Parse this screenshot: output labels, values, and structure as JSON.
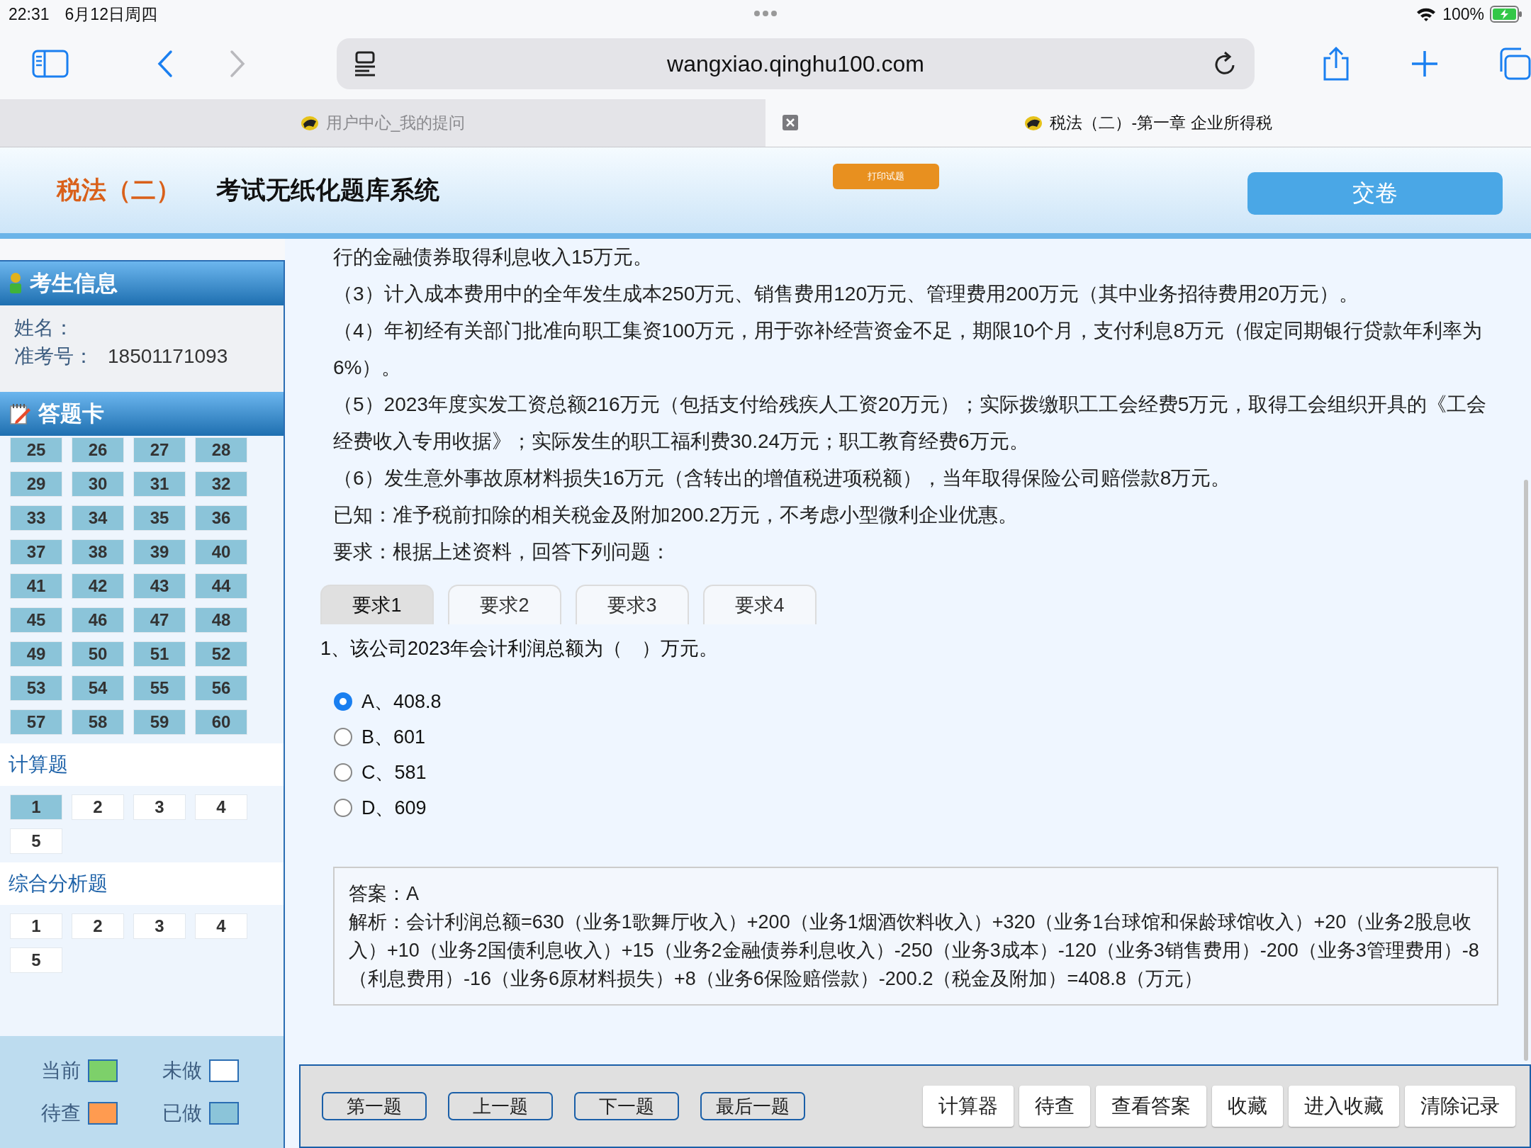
{
  "status_bar": {
    "time": "22:31",
    "date": "6月12日周四",
    "battery": "100%"
  },
  "address_bar": {
    "url": "wangxiao.qinghu100.com"
  },
  "browser_tabs": [
    {
      "title": "用户中心_我的提问",
      "selected": false
    },
    {
      "title": "税法（二）-第一章 企业所得税",
      "selected": true
    }
  ],
  "header": {
    "subject": "税法（二）",
    "system_title": "考试无纸化题库系统",
    "print_button": "打印试题",
    "submit_button": "交卷"
  },
  "sidebar": {
    "info_title": "考生信息",
    "fields": [
      {
        "label": "姓名："
      },
      {
        "label": "准考号：",
        "value": "18501171093"
      }
    ],
    "card_title": "答题卡",
    "sections": [
      {
        "items": [
          {
            "label": "25",
            "done": true
          },
          {
            "label": "26",
            "done": true
          },
          {
            "label": "27",
            "done": true
          },
          {
            "label": "28",
            "done": true
          },
          {
            "label": "29",
            "done": true
          },
          {
            "label": "30",
            "done": true
          },
          {
            "label": "31",
            "done": true
          },
          {
            "label": "32",
            "done": true
          },
          {
            "label": "33",
            "done": true
          },
          {
            "label": "34",
            "done": true
          },
          {
            "label": "35",
            "done": true
          },
          {
            "label": "36",
            "done": true
          },
          {
            "label": "37",
            "done": true
          },
          {
            "label": "38",
            "done": true
          },
          {
            "label": "39",
            "done": true
          },
          {
            "label": "40",
            "done": true
          },
          {
            "label": "41",
            "done": true
          },
          {
            "label": "42",
            "done": true
          },
          {
            "label": "43",
            "done": true
          },
          {
            "label": "44",
            "done": true
          },
          {
            "label": "45",
            "done": true
          },
          {
            "label": "46",
            "done": true
          },
          {
            "label": "47",
            "done": true
          },
          {
            "label": "48",
            "done": true
          },
          {
            "label": "49",
            "done": true
          },
          {
            "label": "50",
            "done": true
          },
          {
            "label": "51",
            "done": true
          },
          {
            "label": "52",
            "done": true
          },
          {
            "label": "53",
            "done": true
          },
          {
            "label": "54",
            "done": true
          },
          {
            "label": "55",
            "done": true
          },
          {
            "label": "56",
            "done": true
          },
          {
            "label": "57",
            "done": true
          },
          {
            "label": "58",
            "done": true
          },
          {
            "label": "59",
            "done": true
          },
          {
            "label": "60",
            "done": true
          }
        ]
      },
      {
        "title": "计算题",
        "items": [
          {
            "label": "1",
            "done": true
          },
          {
            "label": "2",
            "done": false
          },
          {
            "label": "3",
            "done": false
          },
          {
            "label": "4",
            "done": false
          },
          {
            "label": "5",
            "done": false
          }
        ]
      },
      {
        "title": "综合分析题",
        "items": [
          {
            "label": "1",
            "done": false
          },
          {
            "label": "2",
            "done": false
          },
          {
            "label": "3",
            "done": false
          },
          {
            "label": "4",
            "done": false
          },
          {
            "label": "5",
            "done": false
          }
        ]
      }
    ],
    "legend": [
      {
        "label": "当前",
        "color": "#7dd06a"
      },
      {
        "label": "未做",
        "color": "#ffffff"
      },
      {
        "label": "待查",
        "color": "#ff9b50"
      },
      {
        "label": "已做",
        "color": "#8bc4d9"
      }
    ]
  },
  "passage": [
    "行的金融债券取得利息收入15万元。",
    "（3）计入成本费用中的全年发生成本250万元、销售费用120万元、管理费用200万元（其中业务招待费用20万元）。",
    "（4）年初经有关部门批准向职工集资100万元，用于弥补经营资金不足，期限10个月，支付利息8万元（假定同期银行贷款年利率为6%）。",
    "（5）2023年度实发工资总额216万元（包括支付给残疾人工资20万元）；实际拨缴职工工会经费5万元，取得工会组织开具的《工会经费收入专用收据》；实际发生的职工福利费30.24万元；职工教育经费6万元。",
    "（6）发生意外事故原材料损失16万元（含转出的增值税进项税额），当年取得保险公司赔偿款8万元。",
    "已知：准予税前扣除的相关税金及附加200.2万元，不考虑小型微利企业优惠。",
    "要求：根据上述资料，回答下列问题："
  ],
  "sub_tabs": [
    {
      "label": "要求1",
      "selected": true
    },
    {
      "label": "要求2",
      "selected": false
    },
    {
      "label": "要求3",
      "selected": false
    },
    {
      "label": "要求4",
      "selected": false
    }
  ],
  "question": "1、该公司2023年会计利润总额为（　）万元。",
  "options": [
    {
      "label": "A、408.8",
      "selected": true
    },
    {
      "label": "B、601",
      "selected": false
    },
    {
      "label": "C、581",
      "selected": false
    },
    {
      "label": "D、609",
      "selected": false
    }
  ],
  "answer": {
    "answer_line": "答案：A",
    "analysis": "解析：会计利润总额=630（业务1歌舞厅收入）+200（业务1烟酒饮料收入）+320（业务1台球馆和保龄球馆收入）+20（业务2股息收入）+10（业务2国债利息收入）+15（业务2金融债券利息收入）-250（业务3成本）-120（业务3销售费用）-200（业务3管理费用）-8（利息费用）-16（业务6原材料损失）+8（业务6保险赔偿款）-200.2（税金及附加）=408.8（万元）"
  },
  "nav_buttons": [
    "第一题",
    "上一题",
    "下一题",
    "最后一题"
  ],
  "tool_buttons": [
    "计算器",
    "待查",
    "查看答案",
    "收藏",
    "进入收藏",
    "清除记录"
  ]
}
